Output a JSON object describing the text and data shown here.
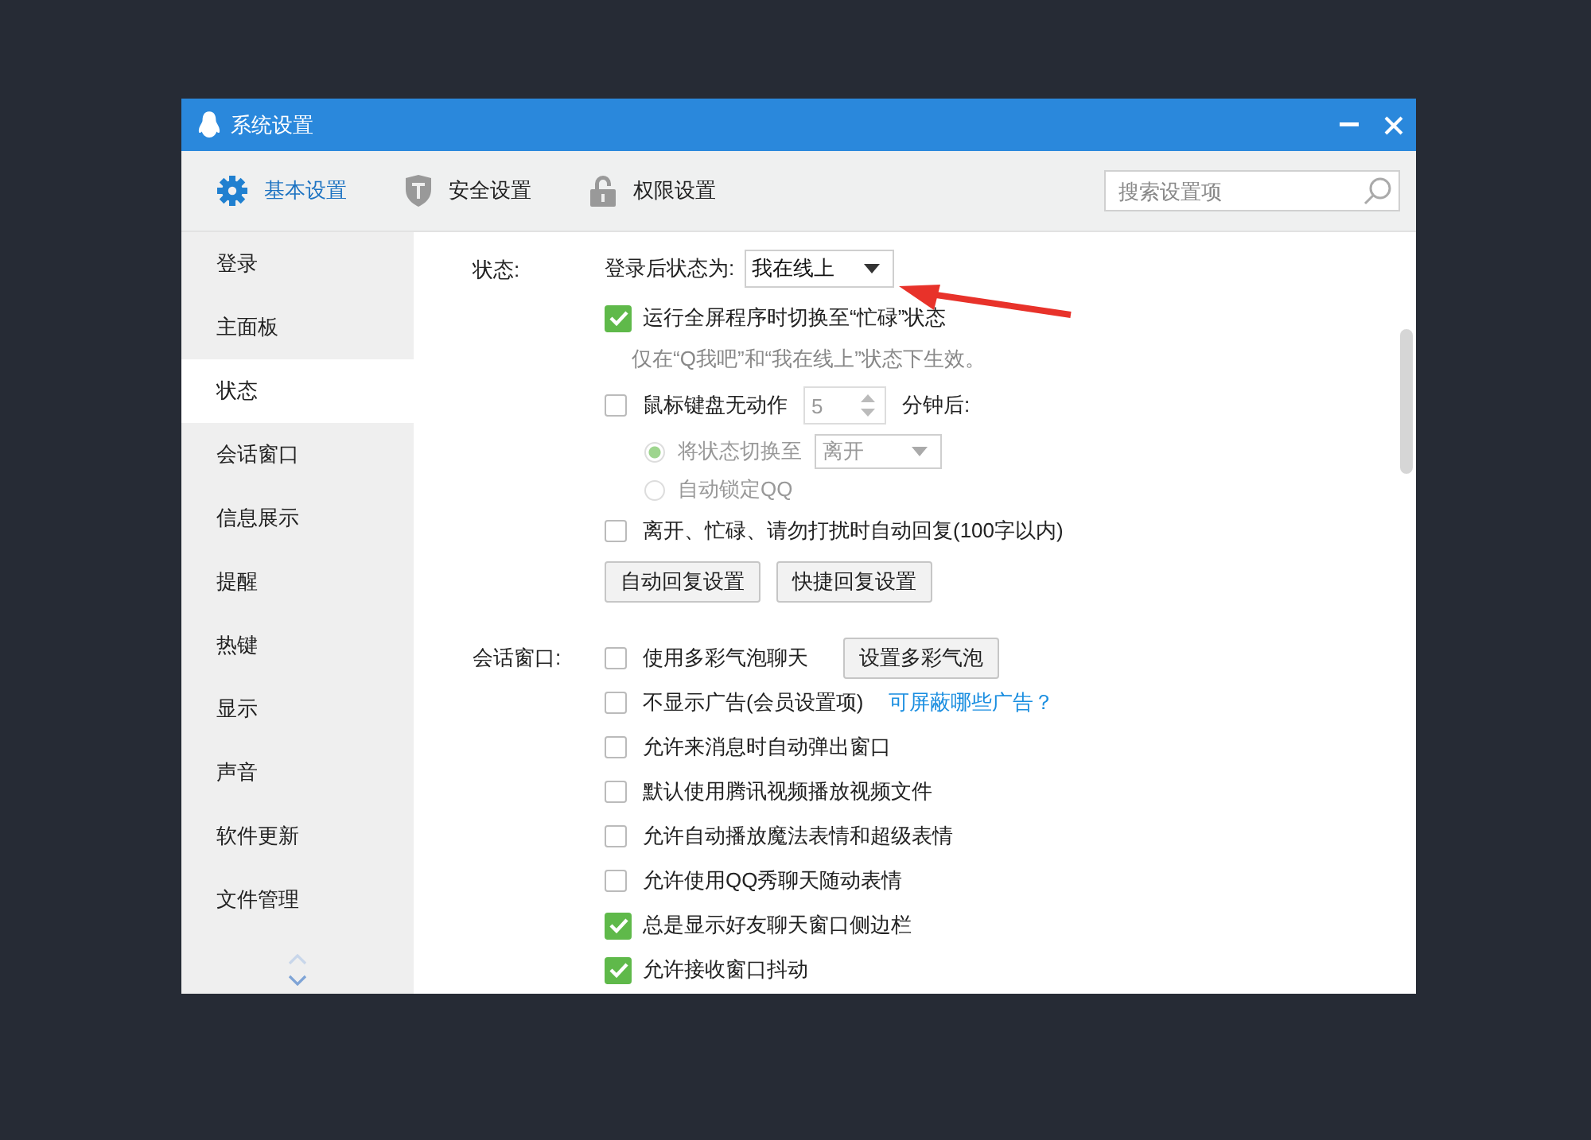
{
  "window": {
    "title": "系统设置"
  },
  "toolbar_tabs": [
    {
      "label": "基本设置",
      "selected": true
    },
    {
      "label": "安全设置",
      "selected": false
    },
    {
      "label": "权限设置",
      "selected": false
    }
  ],
  "search": {
    "placeholder": "搜索设置项"
  },
  "sidebar": {
    "items": [
      {
        "label": "登录",
        "selected": false
      },
      {
        "label": "主面板",
        "selected": false
      },
      {
        "label": "状态",
        "selected": true
      },
      {
        "label": "会话窗口",
        "selected": false
      },
      {
        "label": "信息展示",
        "selected": false
      },
      {
        "label": "提醒",
        "selected": false
      },
      {
        "label": "热键",
        "selected": false
      },
      {
        "label": "显示",
        "selected": false
      },
      {
        "label": "声音",
        "selected": false
      },
      {
        "label": "软件更新",
        "selected": false
      },
      {
        "label": "文件管理",
        "selected": false
      }
    ]
  },
  "sections": [
    {
      "label": "状态:",
      "items": [
        {
          "kind": "dropdown",
          "label": "登录后状态为:",
          "value": "我在线上"
        },
        {
          "kind": "checkbox",
          "label": "运行全屏程序时切换至“忙碌”状态",
          "checked": true
        },
        {
          "kind": "hint",
          "text": "仅在“Q我吧”和“我在线上”状态下生效。"
        },
        {
          "kind": "spin",
          "label": "鼠标键盘无动作",
          "value": "5",
          "suffix": "分钟后:",
          "checked": false
        },
        {
          "kind": "radio",
          "label": "将状态切换至",
          "selected": true,
          "disabled": true,
          "value": "离开"
        },
        {
          "kind": "radio",
          "label": "自动锁定QQ",
          "selected": false,
          "disabled": true
        },
        {
          "kind": "checkbox",
          "label": "离开、忙碌、请勿打扰时自动回复(100字以内)",
          "checked": false
        },
        {
          "kind": "buttons",
          "buttons": [
            "自动回复设置",
            "快捷回复设置"
          ]
        }
      ]
    },
    {
      "label": "会话窗口:",
      "items": [
        {
          "kind": "checkbox",
          "label": "使用多彩气泡聊天",
          "checked": false,
          "button": "设置多彩气泡"
        },
        {
          "kind": "checkbox",
          "label": "不显示广告(会员设置项)",
          "checked": false,
          "link": "可屏蔽哪些广告？"
        },
        {
          "kind": "checkbox",
          "label": "允许来消息时自动弹出窗口",
          "checked": false
        },
        {
          "kind": "checkbox",
          "label": "默认使用腾讯视频播放视频文件",
          "checked": false
        },
        {
          "kind": "checkbox",
          "label": "允许自动播放魔法表情和超级表情",
          "checked": false
        },
        {
          "kind": "checkbox",
          "label": "允许使用QQ秀聊天随动表情",
          "checked": false
        },
        {
          "kind": "checkbox",
          "label": "总是显示好友聊天窗口侧边栏",
          "checked": true
        },
        {
          "kind": "checkbox",
          "label": "允许接收窗口抖动",
          "checked": true
        }
      ]
    }
  ]
}
